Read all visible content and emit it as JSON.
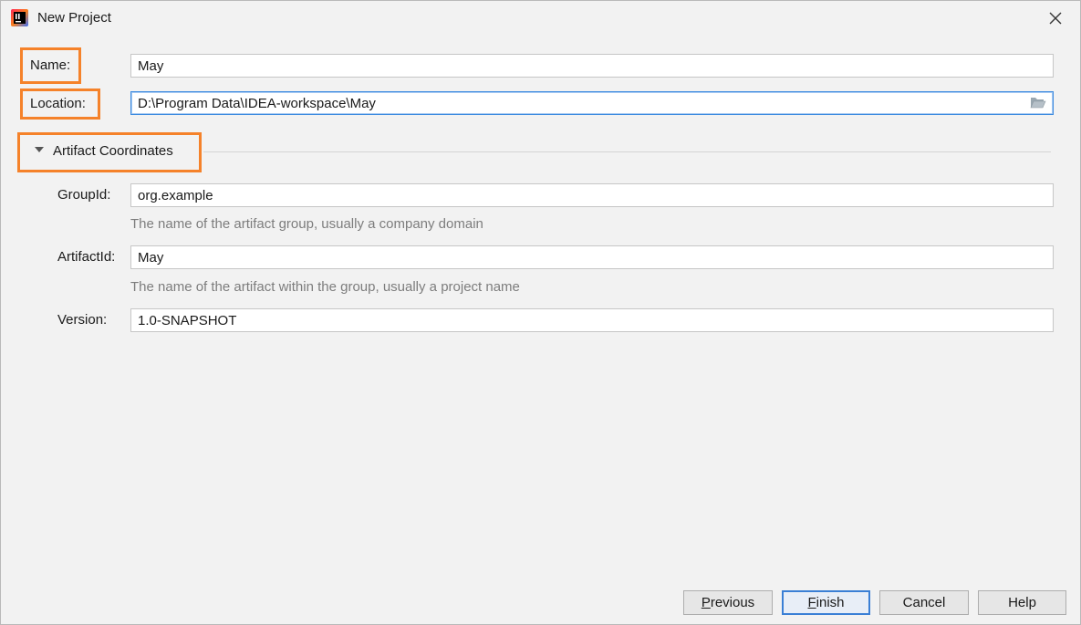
{
  "window": {
    "title": "New Project",
    "app_icon": "intellij-idea-icon",
    "close_icon": "close-icon"
  },
  "form": {
    "name_label": "Name:",
    "name_value": "May",
    "location_label": "Location:",
    "location_value": "D:\\Program Data\\IDEA-workspace\\May",
    "browse_icon": "folder-icon"
  },
  "artifact": {
    "section_title": "Artifact Coordinates",
    "expanded": true,
    "group_id_label": "GroupId:",
    "group_id_value": "org.example",
    "group_id_hint": "The name of the artifact group, usually a company domain",
    "artifact_id_label": "ArtifactId:",
    "artifact_id_value": "May",
    "artifact_id_hint": "The name of the artifact within the group, usually a project name",
    "version_label": "Version:",
    "version_value": "1.0-SNAPSHOT"
  },
  "buttons": {
    "previous_mnemonic": "P",
    "previous_rest": "revious",
    "finish_mnemonic": "F",
    "finish_rest": "inish",
    "cancel": "Cancel",
    "help": "Help"
  },
  "colors": {
    "highlight_box": "#f5822a",
    "focus_border": "#3d8be0",
    "default_button_border": "#3a7fd5",
    "hint_text": "#7d7d7d",
    "background": "#f2f2f2"
  }
}
